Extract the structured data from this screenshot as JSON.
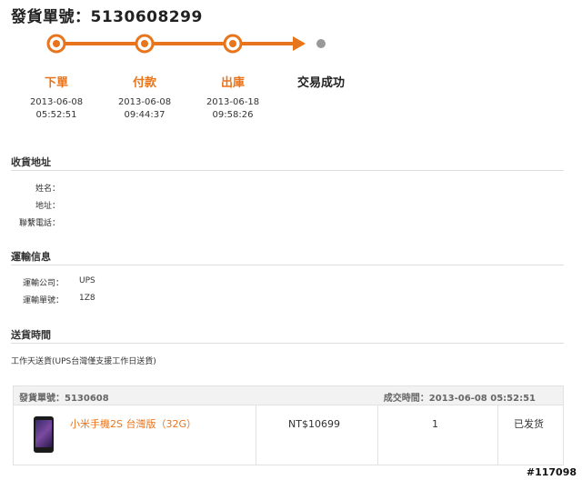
{
  "header": {
    "title": "發貨單號：5130608299"
  },
  "progress": {
    "steps": [
      {
        "label": "下單",
        "date": "2013-06-08",
        "time": "05:52:51"
      },
      {
        "label": "付款",
        "date": "2013-06-08",
        "time": "09:44:37"
      },
      {
        "label": "出庫",
        "date": "2013-06-18",
        "time": "09:58:26"
      },
      {
        "label": "交易成功"
      }
    ],
    "accent_color": "#e8741c",
    "pending_color": "#999999"
  },
  "shipping_address": {
    "heading": "收貨地址",
    "name_label": "姓名：",
    "address_label": "地址：",
    "phone_label": "聯繫電話："
  },
  "transport": {
    "heading": "運輸信息",
    "company_label": "運輸公司：",
    "company_value": "UPS",
    "tracking_label": "運輸單號：",
    "tracking_value": "1Z8"
  },
  "delivery_time": {
    "heading": "送貨時間",
    "note": "工作天送貨(UPS台灣僅支援工作日送貨)"
  },
  "order": {
    "number_label": "發貨單號：5130608",
    "deal_time": "成交時間：2013-06-08 05:52:51",
    "item": {
      "name": "小米手機2S 台灣版（32G）",
      "price": "NT$10699",
      "quantity": "1",
      "status": "已发货"
    }
  },
  "watermark": "#117098"
}
